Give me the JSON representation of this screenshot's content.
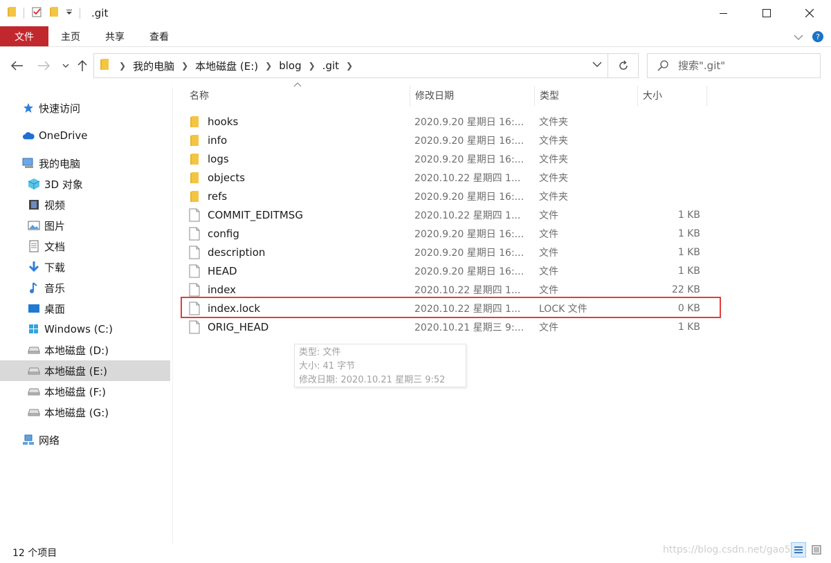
{
  "window": {
    "title": ".git",
    "controls": [
      "minimize-icon",
      "maximize-icon",
      "close-icon"
    ]
  },
  "ribbon": {
    "file_tab": "文件",
    "tabs": [
      "主页",
      "共享",
      "查看"
    ]
  },
  "address": {
    "breadcrumbs": [
      "我的电脑",
      "本地磁盘 (E:)",
      "blog",
      ".git"
    ]
  },
  "search": {
    "placeholder": "搜索\".git\""
  },
  "sidebar": {
    "items": [
      {
        "label": "快速访问",
        "icon": "star-icon",
        "indent": 0
      },
      {
        "label": "OneDrive",
        "icon": "cloud-icon",
        "indent": 0
      },
      {
        "label": "我的电脑",
        "icon": "computer-icon",
        "indent": 0
      },
      {
        "label": "3D 对象",
        "icon": "cube-icon",
        "indent": 1
      },
      {
        "label": "视频",
        "icon": "film-icon",
        "indent": 1
      },
      {
        "label": "图片",
        "icon": "picture-icon",
        "indent": 1
      },
      {
        "label": "文档",
        "icon": "document-icon",
        "indent": 1
      },
      {
        "label": "下载",
        "icon": "download-icon",
        "indent": 1
      },
      {
        "label": "音乐",
        "icon": "music-icon",
        "indent": 1
      },
      {
        "label": "桌面",
        "icon": "desktop-icon",
        "indent": 1
      },
      {
        "label": "Windows (C:)",
        "icon": "windows-drive-icon",
        "indent": 1
      },
      {
        "label": "本地磁盘 (D:)",
        "icon": "drive-icon",
        "indent": 1
      },
      {
        "label": "本地磁盘 (E:)",
        "icon": "drive-icon",
        "indent": 1,
        "selected": true
      },
      {
        "label": "本地磁盘 (F:)",
        "icon": "drive-icon",
        "indent": 1
      },
      {
        "label": "本地磁盘 (G:)",
        "icon": "drive-icon",
        "indent": 1
      },
      {
        "label": "网络",
        "icon": "network-icon",
        "indent": 0
      }
    ]
  },
  "columns": {
    "name": "名称",
    "date": "修改日期",
    "type": "类型",
    "size": "大小"
  },
  "files": [
    {
      "name": "hooks",
      "date": "2020.9.20  星期日 16:...",
      "type": "文件夹",
      "size": "",
      "kind": "folder"
    },
    {
      "name": "info",
      "date": "2020.9.20  星期日 16:...",
      "type": "文件夹",
      "size": "",
      "kind": "folder"
    },
    {
      "name": "logs",
      "date": "2020.9.20  星期日 16:...",
      "type": "文件夹",
      "size": "",
      "kind": "folder"
    },
    {
      "name": "objects",
      "date": "2020.10.22  星期四 1...",
      "type": "文件夹",
      "size": "",
      "kind": "folder"
    },
    {
      "name": "refs",
      "date": "2020.9.20  星期日 16:...",
      "type": "文件夹",
      "size": "",
      "kind": "folder"
    },
    {
      "name": "COMMIT_EDITMSG",
      "date": "2020.10.22  星期四 1...",
      "type": "文件",
      "size": "1 KB",
      "kind": "file"
    },
    {
      "name": "config",
      "date": "2020.9.20  星期日 16:...",
      "type": "文件",
      "size": "1 KB",
      "kind": "file"
    },
    {
      "name": "description",
      "date": "2020.9.20  星期日 16:...",
      "type": "文件",
      "size": "1 KB",
      "kind": "file"
    },
    {
      "name": "HEAD",
      "date": "2020.9.20  星期日 16:...",
      "type": "文件",
      "size": "1 KB",
      "kind": "file"
    },
    {
      "name": "index",
      "date": "2020.10.22  星期四 1...",
      "type": "文件",
      "size": "22 KB",
      "kind": "file"
    },
    {
      "name": "index.lock",
      "date": "2020.10.22  星期四 1...",
      "type": "LOCK 文件",
      "size": "0 KB",
      "kind": "file",
      "highlighted": true
    },
    {
      "name": "ORIG_HEAD",
      "date": "2020.10.21  星期三 9:...",
      "type": "文件",
      "size": "1 KB",
      "kind": "file"
    }
  ],
  "tooltip": {
    "lines": [
      "类型: 文件",
      "大小: 41 字节",
      "修改日期: 2020.10.21  星期三 9:52"
    ]
  },
  "status": {
    "item_count": "12 个项目",
    "watermark": "https://blog.csdn.net/gao5"
  },
  "colors": {
    "file_tab": "#c0282d",
    "highlight": "#e53b3b",
    "folder": "#f4c542",
    "selection": "#d9d9d9"
  }
}
